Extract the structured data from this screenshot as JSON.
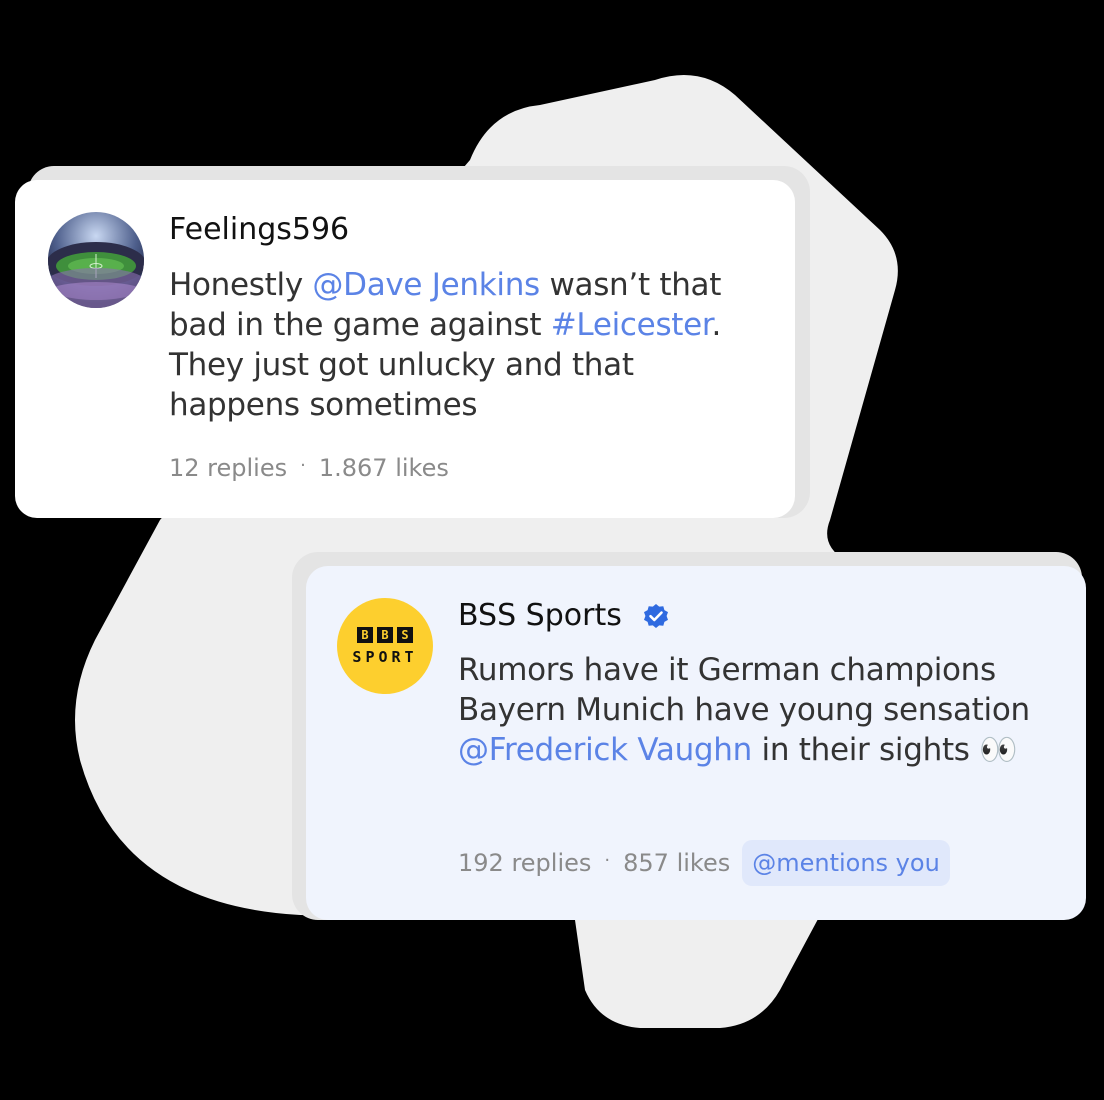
{
  "post1": {
    "username": "Feelings596",
    "avatar_icon": "stadium-icon",
    "text_parts": {
      "p1": "Honestly ",
      "m1": "@Dave Jenkins",
      "p2": " wasn’t that bad in the game against ",
      "m2": "#Leicester",
      "p3": ". They just got unlucky and that happens sometimes"
    },
    "replies": "12 replies",
    "separator": "·",
    "likes": "1.867 likes"
  },
  "post2": {
    "username": "BSS Sports",
    "verified_icon": "verified-badge-icon",
    "logo_letters": [
      "B",
      "B",
      "S"
    ],
    "logo_word": "SPORT",
    "text_parts": {
      "p1": "Rumors have it German champions Bayern Munich have young sensation ",
      "m1": "@Frederick Vaughn",
      "p2": " in their sights ",
      "emoji": "👀"
    },
    "replies": "192 replies",
    "separator": "·",
    "likes": "857 likes",
    "mentions_tag": "@mentions you"
  },
  "colors": {
    "mention": "#5b83e6",
    "card_white": "#ffffff",
    "card_blue": "#f0f4fd",
    "logo_yellow": "#fdcf2e",
    "verified_blue": "#2f6ae0",
    "background_shape": "#efefef"
  }
}
